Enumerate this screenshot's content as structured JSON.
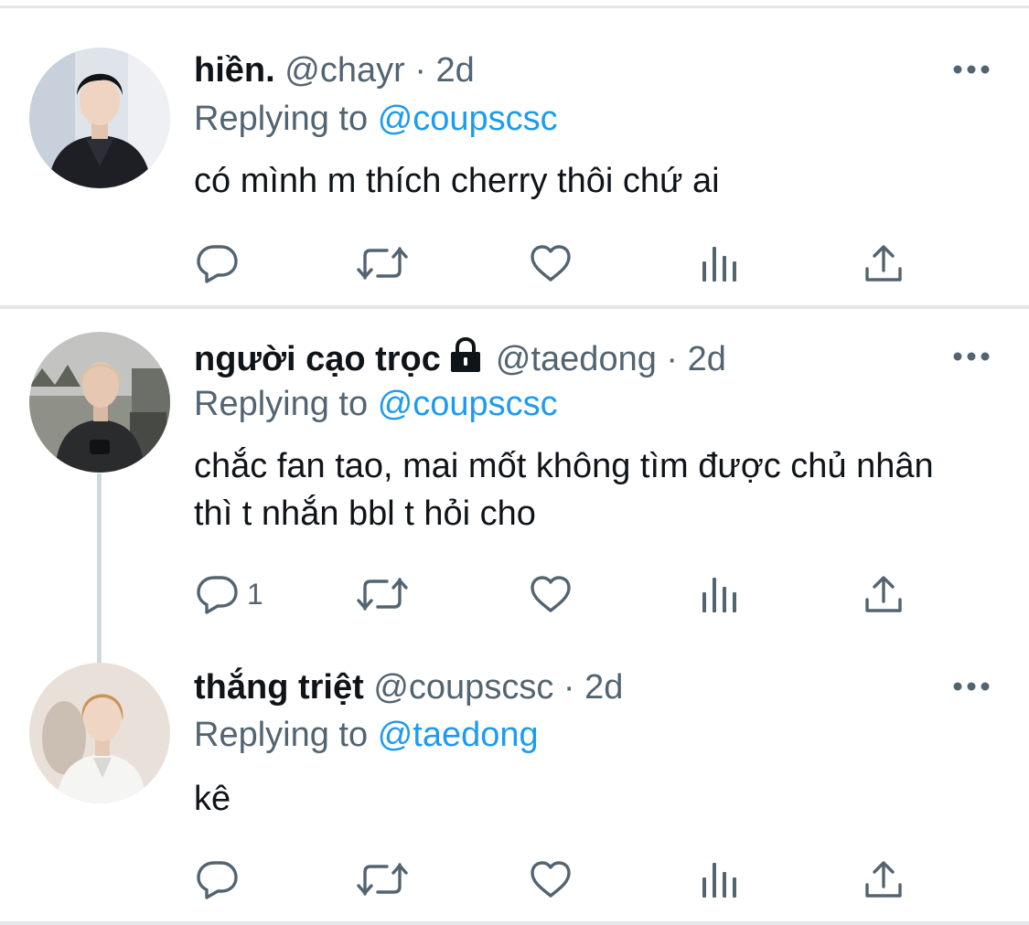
{
  "tweets": [
    {
      "name": "hiền.",
      "handle": "@chayr",
      "separator": "·",
      "time": "2d",
      "replying_prefix": "Replying to",
      "replying_to": "@coupscsc",
      "text": "có mình m thích cherry thôi chứ ai",
      "reply_count": "",
      "locked": false
    },
    {
      "name": "người cạo trọc",
      "handle": "@taedong",
      "separator": "·",
      "time": "2d",
      "replying_prefix": "Replying to",
      "replying_to": "@coupscsc",
      "text": "chắc fan tao, mai mốt không tìm được chủ nhân thì t nhắn bbl t hỏi cho",
      "reply_count": "1",
      "locked": true
    },
    {
      "name": "thắng triệt",
      "handle": "@coupscsc",
      "separator": "·",
      "time": "2d",
      "replying_prefix": "Replying to",
      "replying_to": "@taedong",
      "text": "kê",
      "reply_count": "",
      "locked": false
    }
  ],
  "icons": {
    "reply": "reply-icon",
    "retweet": "retweet-icon",
    "like": "heart-icon",
    "analytics": "analytics-icon",
    "share": "share-icon",
    "more": "more-icon",
    "lock": "lock-icon"
  },
  "colors": {
    "text": "#0f1419",
    "secondary": "#536471",
    "link": "#1d9bf0",
    "divider": "#e4e7ea",
    "thread_line": "#cfd9de"
  }
}
